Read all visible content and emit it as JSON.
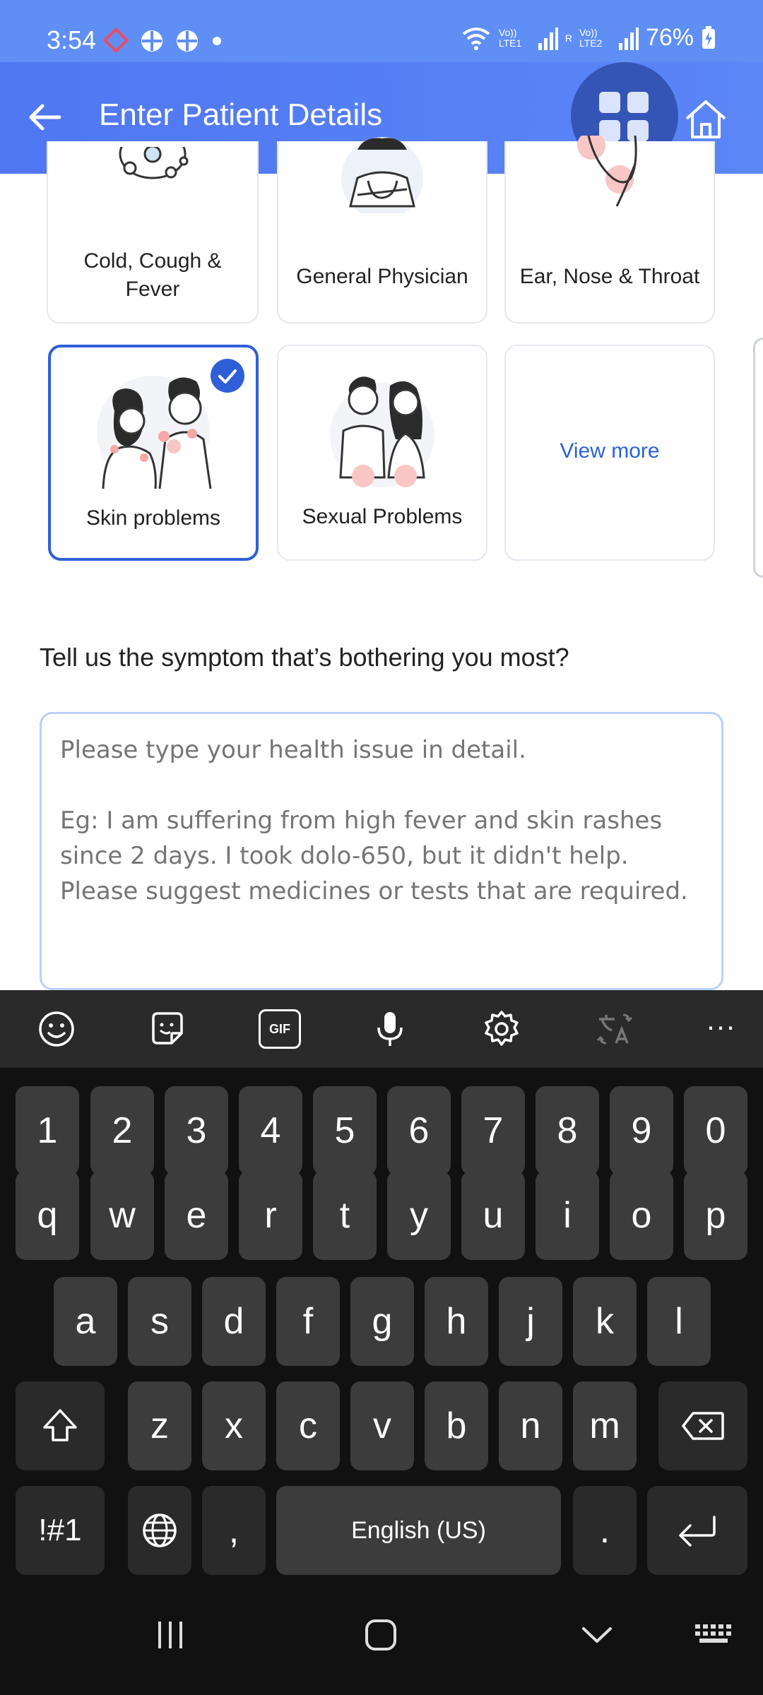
{
  "status_bar": {
    "time": "3:54",
    "battery": "76%",
    "network_labels": [
      "Vo)) LTE1",
      "R",
      "Vo)) LTE2"
    ]
  },
  "app_bar": {
    "title": "Enter Patient Details",
    "back_icon": "arrow-left-icon",
    "apps_icon": "grid-icon",
    "home_icon": "home-icon"
  },
  "categories": {
    "row1": [
      {
        "label": "Cold, Cough &\nFever"
      },
      {
        "label": "General Physician"
      },
      {
        "label": "Ear, Nose & Throat"
      }
    ],
    "row2": [
      {
        "label": "Skin problems",
        "selected": true
      },
      {
        "label": "Sexual Problems",
        "selected": false
      }
    ],
    "view_more": "View more"
  },
  "symptom": {
    "question": "Tell us the symptom that’s bothering you most?",
    "placeholder": "Please type your health issue in detail.\n\nEg: I am suffering from high fever and skin rashes since 2 days. I took dolo-650, but it didn't help. Please suggest medicines or tests that are required.",
    "value": ""
  },
  "keyboard": {
    "toolbar": [
      "emoji-icon",
      "sticker-icon",
      "gif-icon",
      "microphone-icon",
      "settings-icon",
      "translate-icon",
      "more-icon"
    ],
    "gif_label": "GIF",
    "more_label": "···",
    "row_numbers": [
      "1",
      "2",
      "3",
      "4",
      "5",
      "6",
      "7",
      "8",
      "9",
      "0"
    ],
    "row_q": [
      "q",
      "w",
      "e",
      "r",
      "t",
      "y",
      "u",
      "i",
      "o",
      "p"
    ],
    "row_a": [
      "a",
      "s",
      "d",
      "f",
      "g",
      "h",
      "j",
      "k",
      "l"
    ],
    "row_z": [
      "z",
      "x",
      "c",
      "v",
      "b",
      "n",
      "m"
    ],
    "symbols_label": "!#1",
    "comma": ",",
    "space_label": "English (US)",
    "period": "."
  },
  "colors": {
    "accent": "#2f5fd8",
    "appbar": "#5b86f6",
    "keyboard_bg": "#111111",
    "key_bg": "#3c3c3c"
  }
}
